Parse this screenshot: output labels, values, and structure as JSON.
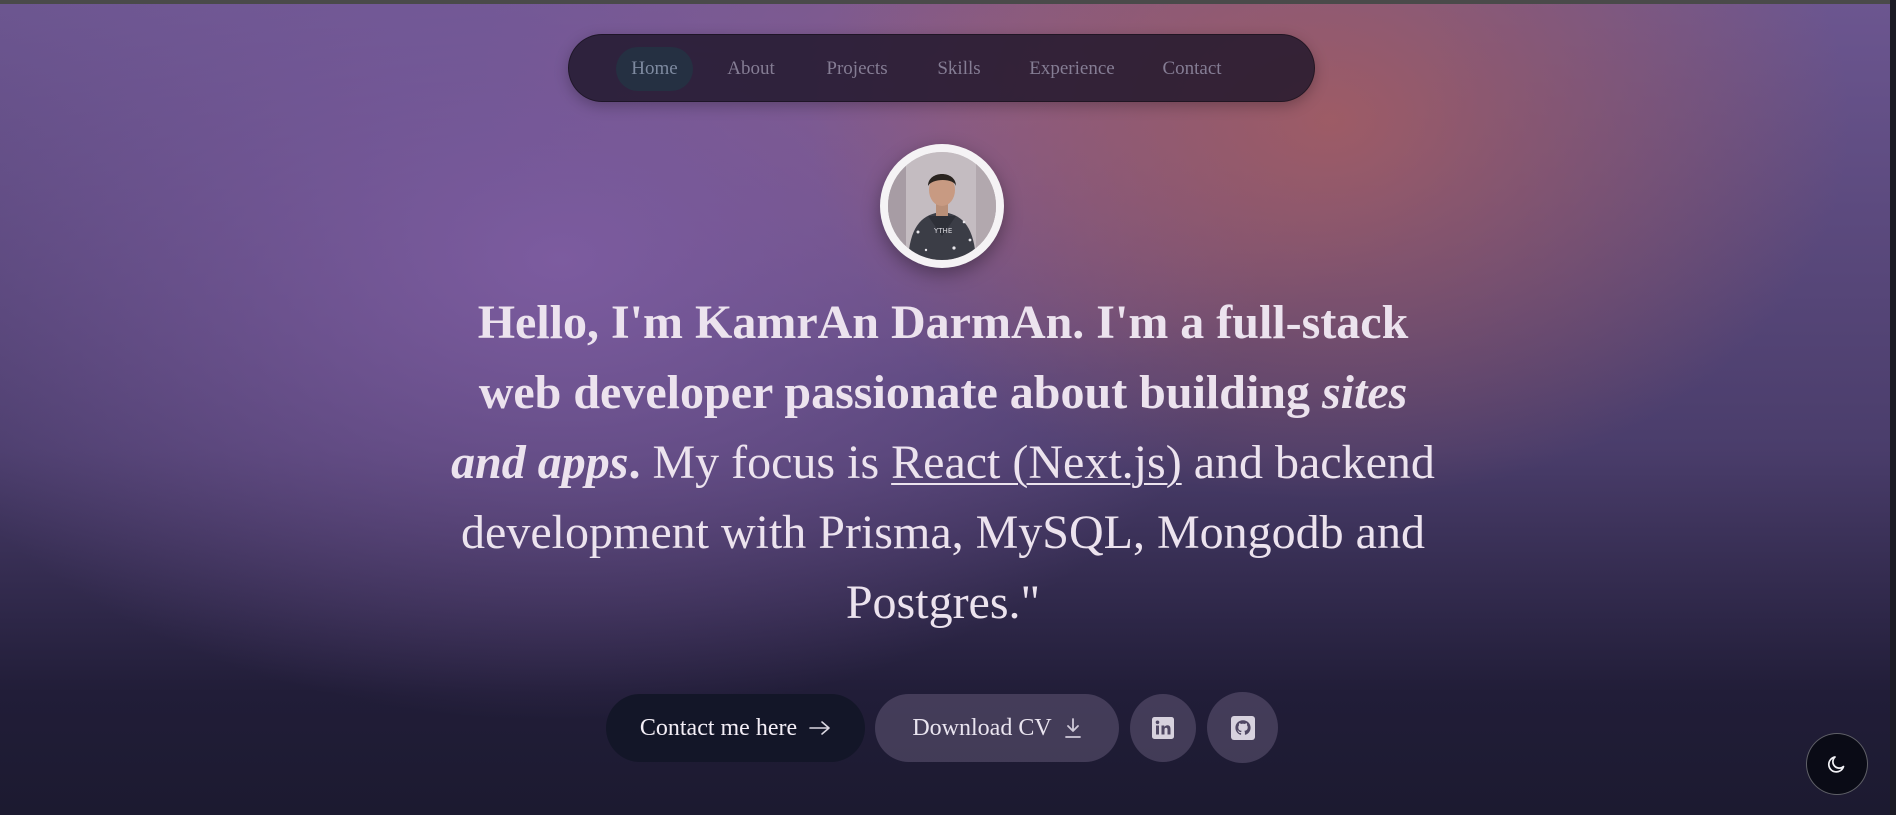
{
  "nav": {
    "items": [
      {
        "label": "Home",
        "active": true
      },
      {
        "label": "About"
      },
      {
        "label": "Projects"
      },
      {
        "label": "Skills"
      },
      {
        "label": "Experience"
      },
      {
        "label": "Contact"
      }
    ]
  },
  "profile": {
    "photo_shirt_text": "YTHE"
  },
  "intro": {
    "part1": "Hello, I'm KamrAn DarmAn. I'm a full-stack web developer passionate about building ",
    "part2": "sites and apps",
    "part3": ".",
    "part4": " My focus is ",
    "link": "React (Next.js)",
    "part5": " and backend development with Prisma, MySQL, Mongodb and Postgres.\""
  },
  "actions": {
    "contact_label": "Contact me here",
    "cv_label": "Download CV"
  },
  "icons": {
    "contact": "arrow-right-icon",
    "cv": "download-icon",
    "linkedin": "linkedin-icon",
    "github": "github-icon",
    "theme": "moon-icon"
  }
}
